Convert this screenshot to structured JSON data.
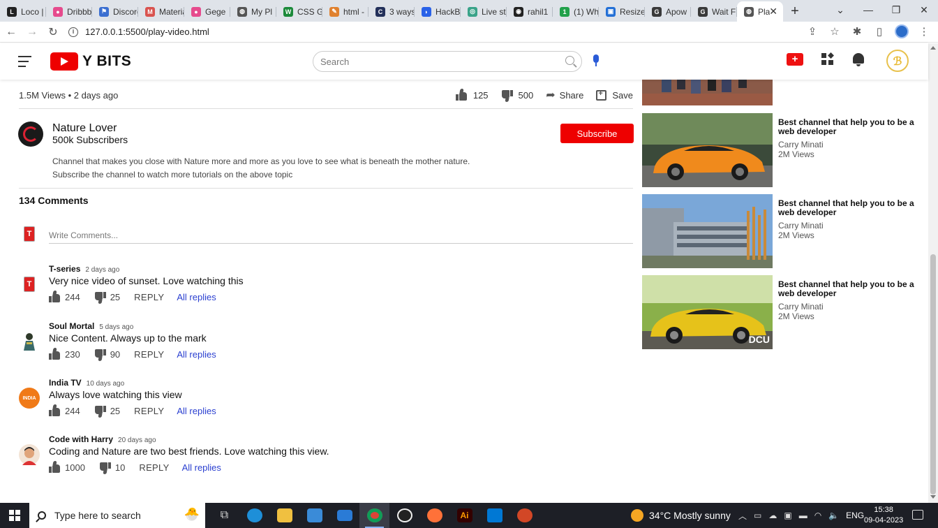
{
  "browser": {
    "tabs": [
      {
        "title": "Loco |",
        "color": "#222222",
        "glyph": "L"
      },
      {
        "title": "Dribbble",
        "color": "#e64b8d",
        "glyph": "●"
      },
      {
        "title": "Discord",
        "color": "#3b6fd1",
        "glyph": "⚑"
      },
      {
        "title": "Material",
        "color": "#d9534f",
        "glyph": "M"
      },
      {
        "title": "Gege",
        "color": "#e64b8d",
        "glyph": "●"
      },
      {
        "title": "My Pl",
        "color": "#555555",
        "glyph": "◍"
      },
      {
        "title": "CSS G",
        "color": "#1c8a3a",
        "glyph": "W"
      },
      {
        "title": "html -",
        "color": "#e0812f",
        "glyph": "✎"
      },
      {
        "title": "3 ways",
        "color": "#23305a",
        "glyph": "C"
      },
      {
        "title": "HackB",
        "color": "#2a62e8",
        "glyph": "◗"
      },
      {
        "title": "Live st",
        "color": "#3aa389",
        "glyph": "◎"
      },
      {
        "title": "rahil1",
        "color": "#222222",
        "glyph": "◉"
      },
      {
        "title": "(1) Wh",
        "color": "#22a14b",
        "glyph": "1"
      },
      {
        "title": "Resize",
        "color": "#2470d6",
        "glyph": "▣"
      },
      {
        "title": "Apow",
        "color": "#3a3a3a",
        "glyph": "G"
      },
      {
        "title": "Wait F",
        "color": "#3a3a3a",
        "glyph": "G"
      },
      {
        "title": "Pla",
        "color": "#555555",
        "glyph": "◍",
        "active": true
      }
    ],
    "url": "127.0.0.1:5500/play-video.html"
  },
  "header": {
    "brand": "Y BITS",
    "search_placeholder": "Search"
  },
  "video": {
    "views_line": "1.5M Views • 2 days ago",
    "likes": "125",
    "dislikes": "500",
    "share_label": "Share",
    "save_label": "Save"
  },
  "channel": {
    "name": "Nature Lover",
    "subscribers": "500k Subscribers",
    "subscribe_label": "Subscribe",
    "desc_line1": "Channel that makes you close with Nature more and more as you love to see what is beneath the mother nature.",
    "desc_line2": "Subscribe the channel to watch more tutorials on the above topic"
  },
  "comments": {
    "title": "134 Comments",
    "write_placeholder": "Write Comments...",
    "items": [
      {
        "author": "T-series",
        "time": "2 days ago",
        "text": "Very nice video of sunset. Love watching this",
        "likes": "244",
        "dislikes": "25",
        "reply": "REPLY",
        "all_replies": "All replies"
      },
      {
        "author": "Soul Mortal",
        "time": "5 days ago",
        "text": "Nice Content. Always up to the mark",
        "likes": "230",
        "dislikes": "90",
        "reply": "REPLY",
        "all_replies": "All replies"
      },
      {
        "author": "India TV",
        "time": "10 days ago",
        "text": "Always love watching this view",
        "likes": "244",
        "dislikes": "25",
        "reply": "REPLY",
        "all_replies": "All replies"
      },
      {
        "author": "Code with Harry",
        "time": "20 days ago",
        "text": "Coding and Nature are two best friends. Love watching this view.",
        "likes": "1000",
        "dislikes": "10",
        "reply": "REPLY",
        "all_replies": "All replies"
      }
    ]
  },
  "sidebar": {
    "items": [
      {
        "title": "Best channel that help you to be a web developer",
        "channel": "Carry Minati",
        "views": "2M Views"
      },
      {
        "title": "Best channel that help you to be a web developer",
        "channel": "Carry Minati",
        "views": "2M Views"
      },
      {
        "title": "Best channel that help you to be a web developer",
        "channel": "Carry Minati",
        "views": "2M Views",
        "watermark": "DCU"
      }
    ]
  },
  "taskbar": {
    "search_placeholder": "Type here to search",
    "weather": "34°C  Mostly sunny",
    "language": "ENG",
    "time": "15:38",
    "date": "09-04-2023"
  }
}
